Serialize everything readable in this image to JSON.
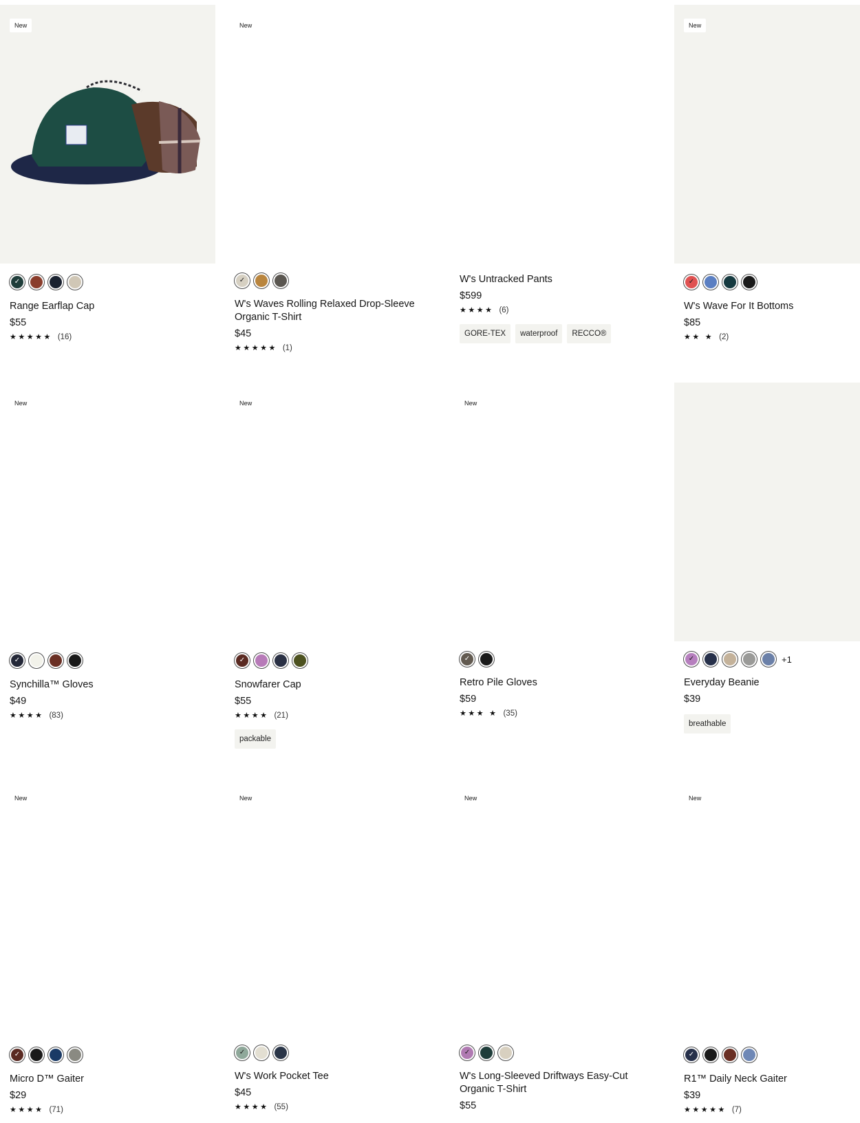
{
  "badge_label": "New",
  "products": [
    {
      "name": "Range Earflap Cap",
      "price": "$55",
      "stars": "★★★★★",
      "count": "(16)",
      "new": true,
      "gray": true,
      "swatches": [
        "#1f3d3a",
        "#8a3d2c",
        "#1a2230",
        "#d0c7b6"
      ],
      "more": "",
      "tags": []
    },
    {
      "name": "W's Waves Rolling Relaxed Drop-Sleeve Organic T-Shirt",
      "price": "$45",
      "stars": "★★★★★",
      "count": "(1)",
      "new": true,
      "gray": false,
      "swatches": [
        "#d6d0c2",
        "#b9853e",
        "#5a5650"
      ],
      "more": "",
      "tags": []
    },
    {
      "name": "W's Untracked Pants",
      "price": "$599",
      "stars": "★★★★",
      "count": "(6)",
      "new": false,
      "gray": false,
      "swatches": [],
      "more": "",
      "tags": [
        "GORE-TEX",
        "waterproof",
        "RECCO®"
      ]
    },
    {
      "name": "W's Wave For It Bottoms",
      "price": "$85",
      "stars": "★★",
      "count": "(2)",
      "new": true,
      "gray": true,
      "swatches": [
        "#e05252",
        "#5b7fc2",
        "#163a40",
        "#1a1a1a"
      ],
      "more": "",
      "tags": []
    },
    {
      "name": "Synchilla™ Gloves",
      "price": "$49",
      "stars": "★★★★",
      "count": "(83)",
      "new": true,
      "gray": false,
      "swatches": [
        "#242838",
        "#f2f2ea",
        "#6a2f24",
        "#1a1a1a"
      ],
      "more": "",
      "tags": []
    },
    {
      "name": "Snowfarer Cap",
      "price": "$55",
      "stars": "★★★★",
      "count": "(21)",
      "new": true,
      "gray": false,
      "swatches": [
        "#5a2a22",
        "#b77ab8",
        "#2a3044",
        "#4d5220"
      ],
      "more": "",
      "tags": [
        "packable"
      ]
    },
    {
      "name": "Retro Pile Gloves",
      "price": "$59",
      "stars": "★★★",
      "count": "(35)",
      "new": true,
      "gray": false,
      "swatches": [
        "#625a50",
        "#1a1a1a"
      ],
      "more": "",
      "tags": []
    },
    {
      "name": "Everyday Beanie",
      "price": "$39",
      "stars": "",
      "count": "",
      "new": false,
      "gray": true,
      "swatches": [
        "#b67fbe",
        "#26304a",
        "#c4b29a",
        "#9a9a98",
        "#6b80a8"
      ],
      "more": "+1",
      "tags": [
        "breathable"
      ]
    },
    {
      "name": "Micro D™ Gaiter",
      "price": "$29",
      "stars": "★★★★",
      "count": "(71)",
      "new": true,
      "gray": false,
      "swatches": [
        "#5a2a22",
        "#1a1a1a",
        "#1a3a66",
        "#8a8a82"
      ],
      "more": "",
      "tags": []
    },
    {
      "name": "W's Work Pocket Tee",
      "price": "$45",
      "stars": "★★★★",
      "count": "(55)",
      "new": true,
      "gray": false,
      "swatches": [
        "#8fa89a",
        "#e3dfd2",
        "#2a3548"
      ],
      "more": "",
      "tags": []
    },
    {
      "name": "W's Long-Sleeved Driftways Easy-Cut Organic T-Shirt",
      "price": "$55",
      "stars": "",
      "count": "",
      "new": true,
      "gray": false,
      "swatches": [
        "#b07ab2",
        "#1f3d3a",
        "#d8d0c0"
      ],
      "more": "",
      "tags": []
    },
    {
      "name": "R1™ Daily Neck Gaiter",
      "price": "$39",
      "stars": "★★★★★",
      "count": "(7)",
      "new": true,
      "gray": false,
      "swatches": [
        "#26304a",
        "#1a1a1a",
        "#6a2f24",
        "#6f88b6"
      ],
      "more": "",
      "tags": []
    }
  ]
}
